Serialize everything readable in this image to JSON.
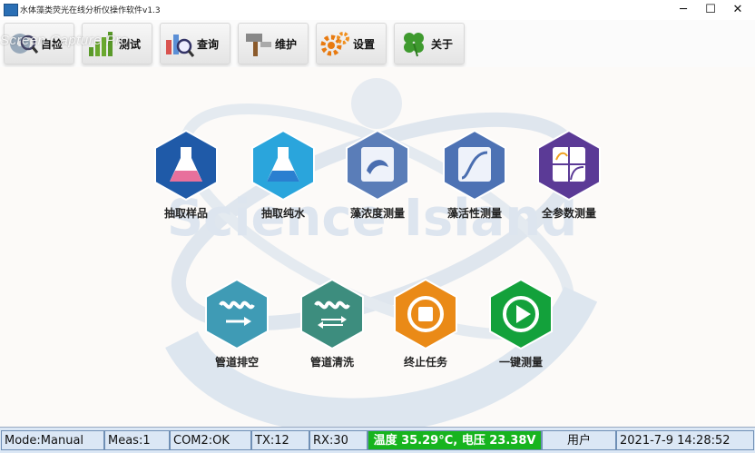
{
  "window": {
    "title": "水体藻类荧光在线分析仪操作软件v1.3",
    "overlay": "Screen Capture Pro"
  },
  "toolbar": {
    "buttons": [
      {
        "label": "自检",
        "icon": "disc-magnifier-icon"
      },
      {
        "label": "测试",
        "icon": "bar-chart-icon"
      },
      {
        "label": "查询",
        "icon": "chart-search-icon"
      },
      {
        "label": "维护",
        "icon": "hammer-icon"
      },
      {
        "label": "设置",
        "icon": "gears-icon"
      },
      {
        "label": "关于",
        "icon": "clover-icon"
      }
    ]
  },
  "watermark": {
    "text": "Science Island"
  },
  "functions": [
    {
      "label": "抽取样品",
      "icon": "flask-sample-icon",
      "color": "#1f5aa8"
    },
    {
      "label": "抽取纯水",
      "icon": "flask-water-icon",
      "color": "#2aa5dc"
    },
    {
      "label": "藻浓度测量",
      "icon": "algae-concentration-icon",
      "color": "#5a7db8"
    },
    {
      "label": "藻活性测量",
      "icon": "algae-activity-icon",
      "color": "#4d72b4"
    },
    {
      "label": "全参数测量",
      "icon": "all-parameters-icon",
      "color": "#5b3a96"
    },
    {
      "label": "管道排空",
      "icon": "pipe-drain-icon",
      "color": "#3f9bb5"
    },
    {
      "label": "管道清洗",
      "icon": "pipe-clean-icon",
      "color": "#3d8d7e"
    },
    {
      "label": "终止任务",
      "icon": "stop-icon",
      "color": "#ea8a17"
    },
    {
      "label": "一键测量",
      "icon": "play-icon",
      "color": "#13a13b"
    }
  ],
  "status": {
    "mode": "Mode:Manual",
    "meas": "Meas:1",
    "com": "COM2:OK",
    "tx": "TX:12",
    "rx": "RX:30",
    "env": "温度 35.29°C, 电压 23.38V",
    "user": "用户",
    "datetime": "2021-7-9 14:28:52"
  }
}
